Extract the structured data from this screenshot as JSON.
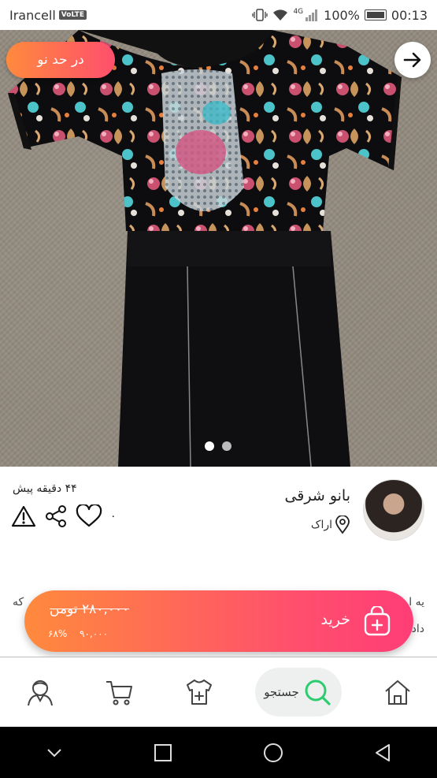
{
  "status_bar": {
    "carrier": "Irancell",
    "volte": "VoLTE",
    "network": "4G",
    "battery": "100%",
    "time": "00:13"
  },
  "listing": {
    "condition_badge": "در حد نو",
    "seller_name": "بانو شرقی",
    "location": "اراک",
    "time_ago": "۴۴ دقیقه پیش",
    "likes": "۰",
    "description_left": "که",
    "description_right": "یه ا",
    "description_right2": "داد",
    "images_count": 2,
    "current_image": 1
  },
  "buy_bar": {
    "old_price": "۲۸۰,۰۰۰ تومن",
    "new_price": "۹۰,۰۰۰",
    "discount": "۶۸%",
    "buy_label": "خرید"
  },
  "bottom_nav": {
    "search_label": "جستجو",
    "items": [
      "profile-icon",
      "cart-icon",
      "add-clothing-icon",
      "search-icon",
      "home-icon"
    ]
  },
  "colors": {
    "accent_start": "#ff8a3d",
    "accent_end": "#ff4f6d",
    "search_green": "#2ecc71"
  }
}
